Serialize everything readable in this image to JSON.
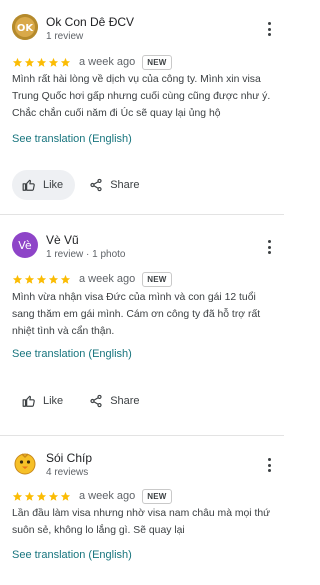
{
  "colors": {
    "star": "#fbbc04",
    "link": "#18757e",
    "avatar_vv": "#8e44c8",
    "avatar_ok_bg": "#b58a2c"
  },
  "reviews": [
    {
      "author": "Ok Con Dê ĐCV",
      "meta": "1 review",
      "avatar_text": "OK",
      "rating": 5,
      "time": "a week ago",
      "badge": "NEW",
      "text_lines": [
        "Mình rất hài lòng về dịch vụ của công ty. Mình xin visa",
        "Trung Quốc hơi gấp nhưng cuối cùng cũng được như ý.",
        "Chắc chắn cuối năm đi Úc sẽ quay lại ủng hộ"
      ],
      "translate": "See translation (English)",
      "like_label": "Like",
      "share_label": "Share"
    },
    {
      "author": "Vè Vũ",
      "meta": "1 review · 1 photo",
      "avatar_text": "Vè",
      "rating": 5,
      "time": "a week ago",
      "badge": "NEW",
      "text_lines": [
        "Mình vừa nhận visa Đức của mình và con gái 12 tuổi",
        "sang thăm em gái mình. Cám ơn công ty đã hỗ trợ rất",
        "nhiệt tình và cẩn thận."
      ],
      "translate": "See translation (English)",
      "like_label": "Like",
      "share_label": "Share"
    },
    {
      "author": "Sói Chíp",
      "meta": "4 reviews",
      "rating": 5,
      "time": "a week ago",
      "badge": "NEW",
      "text_lines": [
        "Lần đầu làm visa nhưng nhờ visa nam châu mà mọi thứ",
        "suôn sẻ, không lo lắng gì. Sẽ quay lại"
      ],
      "translate": "See translation (English)"
    }
  ]
}
